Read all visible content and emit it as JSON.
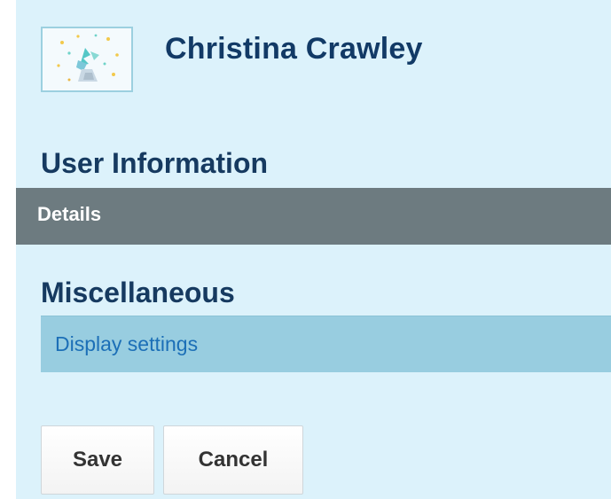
{
  "user": {
    "name": "Christina Crawley"
  },
  "sections": {
    "user_information": {
      "title": "User Information",
      "details_label": "Details"
    },
    "miscellaneous": {
      "title": "Miscellaneous",
      "display_settings_label": "Display settings"
    }
  },
  "actions": {
    "save_label": "Save",
    "cancel_label": "Cancel"
  },
  "colors": {
    "panel_background": "#dcf2fb",
    "details_bar": "#6d7b80",
    "display_settings_bar": "#98cde0",
    "link_text": "#1c6fb7",
    "heading_text": "#163a60"
  },
  "icons": {
    "avatar": "avatar-sparkle-icon"
  }
}
